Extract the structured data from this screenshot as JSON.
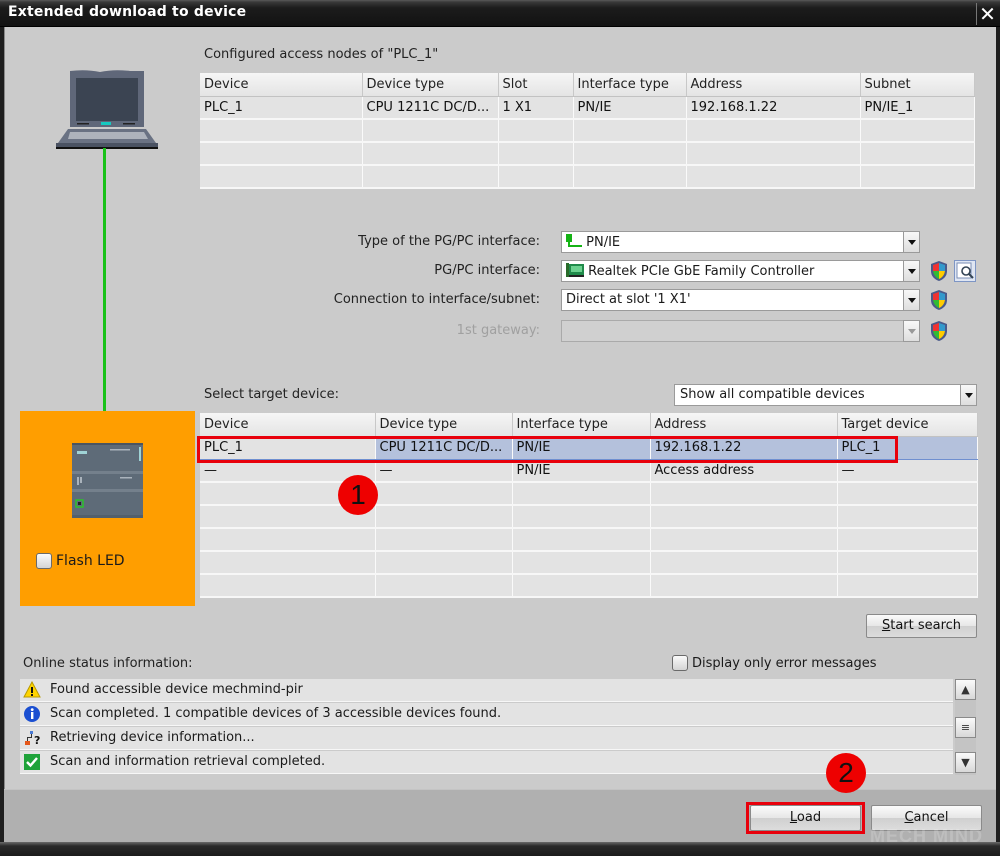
{
  "window": {
    "title": "Extended download to device",
    "close_glyph": "✕"
  },
  "left_panel": {
    "pc_icon": "laptop-icon",
    "plc_icon": "plc-cpu-icon",
    "flash_led_label": "Flash LED",
    "flash_led_checked": false
  },
  "configured_nodes": {
    "label": "Configured access nodes of \"PLC_1\"",
    "columns": [
      "Device",
      "Device type",
      "Slot",
      "Interface type",
      "Address",
      "Subnet"
    ],
    "rows": [
      [
        "PLC_1",
        "CPU 1211C DC/D...",
        "1 X1",
        "PN/IE",
        "192.168.1.22",
        "PN/IE_1"
      ],
      [
        "",
        "",
        "",
        "",
        "",
        ""
      ],
      [
        "",
        "",
        "",
        "",
        "",
        ""
      ],
      [
        "",
        "",
        "",
        "",
        "",
        ""
      ]
    ]
  },
  "interface_settings": {
    "type_label": "Type of the PG/PC interface:",
    "type_value": "PN/IE",
    "interface_label": "PG/PC interface:",
    "interface_value": "Realtek PCIe GbE Family Controller",
    "connection_label": "Connection to interface/subnet:",
    "connection_value": "Direct at slot '1 X1'",
    "gateway_label": "1st gateway:",
    "gateway_value": ""
  },
  "target_devices": {
    "label": "Select target device:",
    "filter_value": "Show all compatible devices",
    "columns": [
      "Device",
      "Device type",
      "Interface type",
      "Address",
      "Target device"
    ],
    "rows": [
      [
        "PLC_1",
        "CPU 1211C DC/D...",
        "PN/IE",
        "192.168.1.22",
        "PLC_1"
      ],
      [
        "—",
        "—",
        "PN/IE",
        "Access address",
        "—"
      ],
      [
        "",
        "",
        "",
        "",
        ""
      ],
      [
        "",
        "",
        "",
        "",
        ""
      ],
      [
        "",
        "",
        "",
        "",
        ""
      ],
      [
        "",
        "",
        "",
        "",
        ""
      ],
      [
        "",
        "",
        "",
        "",
        ""
      ]
    ],
    "selected_row": 0
  },
  "start_search": {
    "label_mnemonic": "S",
    "label_rest": "tart search"
  },
  "online_status": {
    "label": "Online status information:",
    "error_only_label": "Display only error messages",
    "error_only_checked": false,
    "messages": [
      {
        "icon": "warning-icon",
        "text": "Found accessible device mechmind-pir"
      },
      {
        "icon": "info-icon",
        "text": "Scan completed. 1 compatible devices of 3 accessible devices found."
      },
      {
        "icon": "network-query-icon",
        "text": "Retrieving device information..."
      },
      {
        "icon": "success-check-icon",
        "text": "Scan and information retrieval completed."
      }
    ]
  },
  "footer": {
    "load": {
      "mnemonic": "L",
      "rest": "oad"
    },
    "cancel": {
      "mnemonic": "C",
      "rest": "ancel"
    }
  },
  "annotations": {
    "badge_1": "1",
    "badge_2": "2",
    "highlight_color": "#e8000b"
  },
  "watermark": "MECH MIND"
}
